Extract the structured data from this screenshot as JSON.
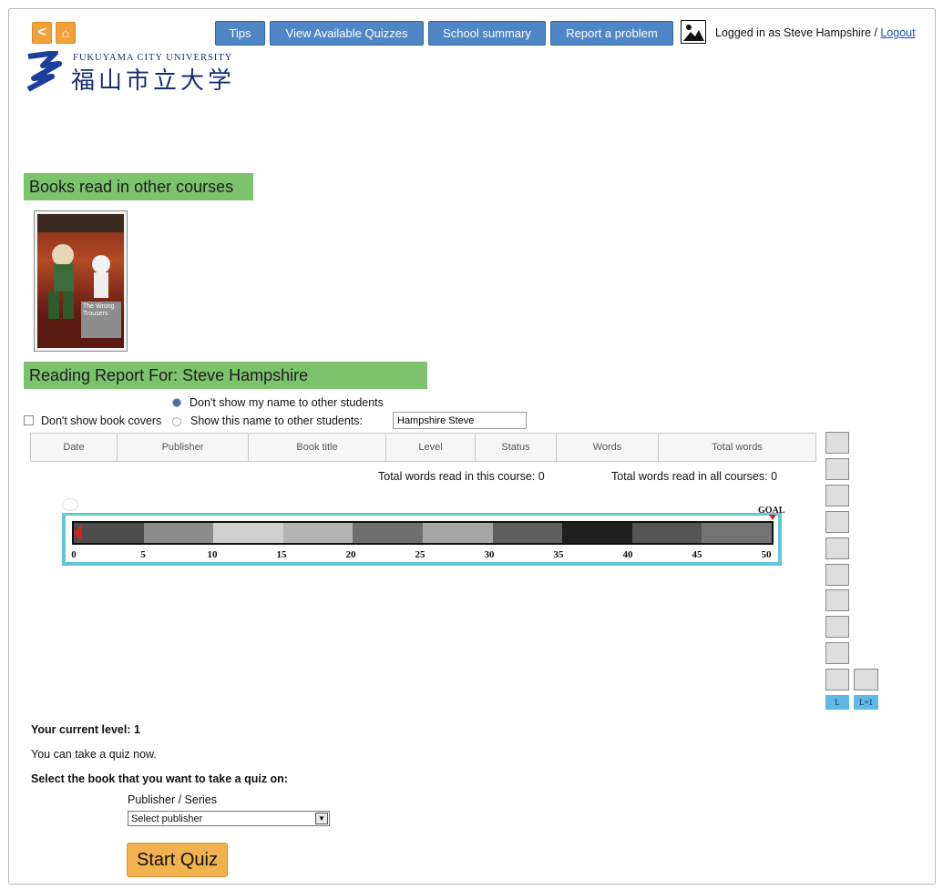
{
  "nav": {
    "back_symbol": "<",
    "home_symbol": "⌂",
    "tips": "Tips",
    "view_quizzes": "View Available Quizzes",
    "school_summary": "School summary",
    "report_problem": "Report a problem",
    "logged_in_text": "Logged in as Steve Hampshire / ",
    "logout": "Logout"
  },
  "logo": {
    "english": "FUKUYAMA CITY UNIVERSITY",
    "japanese": "福山市立大学"
  },
  "books_section": {
    "title": "Books read in other courses",
    "cover_title": "The Wrong Trousers"
  },
  "report": {
    "title": "Reading Report For: Steve Hampshire",
    "hide_name_option": "Don't show my name to other students",
    "hide_covers_label": "Don't show book covers",
    "show_name_label": "Show this name to other students:",
    "name_value": "Hampshire Steve",
    "columns": [
      "Date",
      "Publisher",
      "Book title",
      "Level",
      "Status",
      "Words",
      "Total words"
    ],
    "total_course": "Total words read in this course: 0",
    "total_all": "Total words read in all courses: 0"
  },
  "progress": {
    "goal_label": "GOAL",
    "ticks": [
      "0",
      "5",
      "10",
      "15",
      "20",
      "25",
      "30",
      "35",
      "40",
      "45",
      "50"
    ],
    "current_value": 0,
    "segment_colors": [
      "#4d4d4d",
      "#8c8c8c",
      "#d0d0d0",
      "#b3b3b3",
      "#6f6f6f",
      "#a6a6a6",
      "#5e5e5e",
      "#1f1f1f",
      "#545454",
      "#737373"
    ],
    "frame_color": "#62c7d6"
  },
  "level_tags": {
    "current": "L",
    "next": "L+1"
  },
  "bottom": {
    "current_level": "Your current level: 1",
    "quiz_now": "You can take a quiz now.",
    "select_book": "Select the book that you want to take a quiz on:",
    "publisher_label": "Publisher / Series",
    "publisher_selected": "Select publisher",
    "start_quiz": "Start Quiz"
  }
}
